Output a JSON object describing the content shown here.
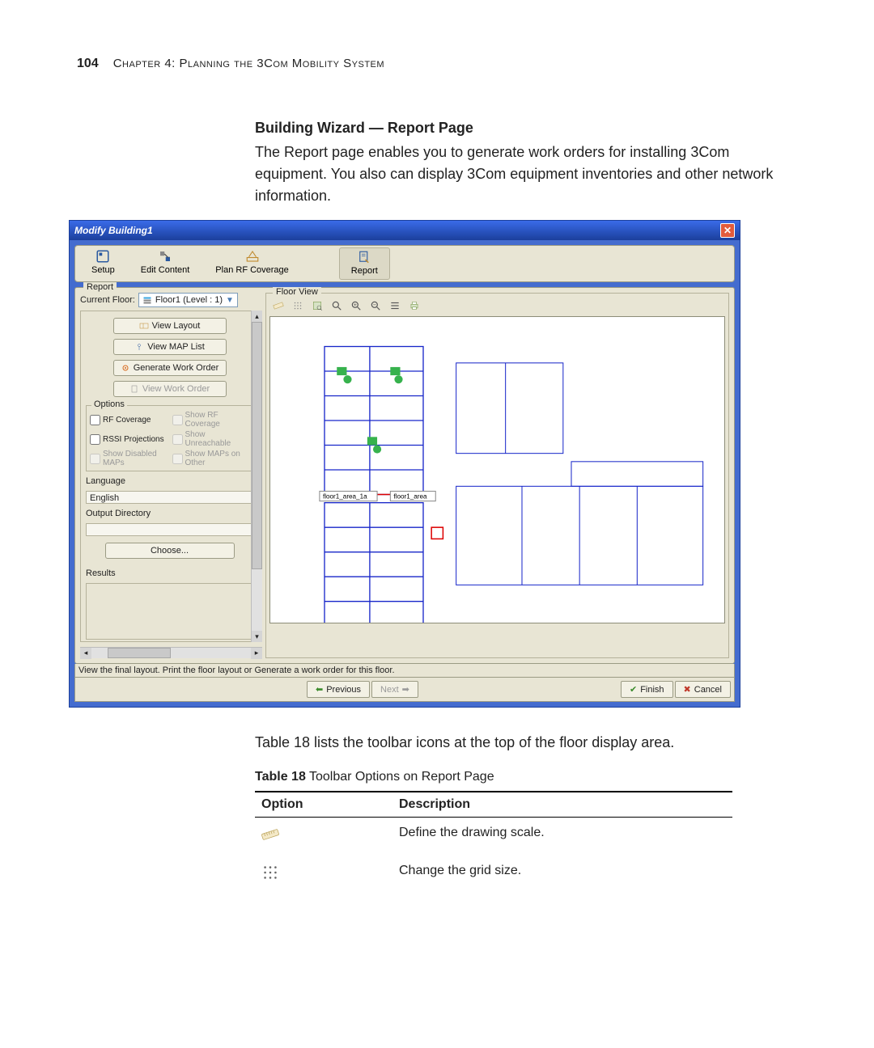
{
  "page_number": "104",
  "chapter_label": "Chapter 4: Planning the 3Com Mobility System",
  "section_title": "Building Wizard — Report Page",
  "intro_para": "The Report page enables you to generate work orders for installing 3Com equipment. You also can display 3Com equipment inventories and other network information.",
  "window": {
    "title": "Modify Building1",
    "tabs": {
      "setup": "Setup",
      "edit_content": "Edit Content",
      "plan_rf": "Plan RF Coverage",
      "report": "Report"
    },
    "panel_legend": "Report",
    "current_floor_label": "Current Floor:",
    "current_floor_value": "Floor1 (Level : 1)",
    "buttons": {
      "view_layout": "View Layout",
      "view_map_list": "View MAP List",
      "gen_work_order": "Generate Work Order",
      "view_work_order": "View Work Order",
      "choose": "Choose..."
    },
    "options_legend": "Options",
    "options": {
      "rf_coverage": "RF Coverage",
      "show_rf_coverage": "Show RF Coverage",
      "rssi_projections": "RSSI Projections",
      "show_unreachable": "Show Unreachable",
      "show_disabled_maps": "Show Disabled MAPs",
      "show_maps_other": "Show MAPs on Other"
    },
    "language_label": "Language",
    "language_value": "English",
    "output_dir_label": "Output Directory",
    "results_label": "Results",
    "floor_view_label": "Floor View",
    "floor_area_labels": {
      "a": "floor1_area_1a",
      "b": "floor1_area"
    },
    "status_text": "View the final layout. Print the floor layout or  Generate a work order for this floor.",
    "wizard": {
      "previous": "Previous",
      "next": "Next",
      "finish": "Finish",
      "cancel": "Cancel"
    }
  },
  "below_para": "Table 18 lists the toolbar icons at the top of the floor display area.",
  "table": {
    "caption_bold": "Table 18",
    "caption_rest": "   Toolbar Options on Report Page",
    "header_option": "Option",
    "header_desc": "Description",
    "rows": [
      {
        "desc": "Define the drawing scale."
      },
      {
        "desc": "Change the grid size."
      }
    ]
  }
}
